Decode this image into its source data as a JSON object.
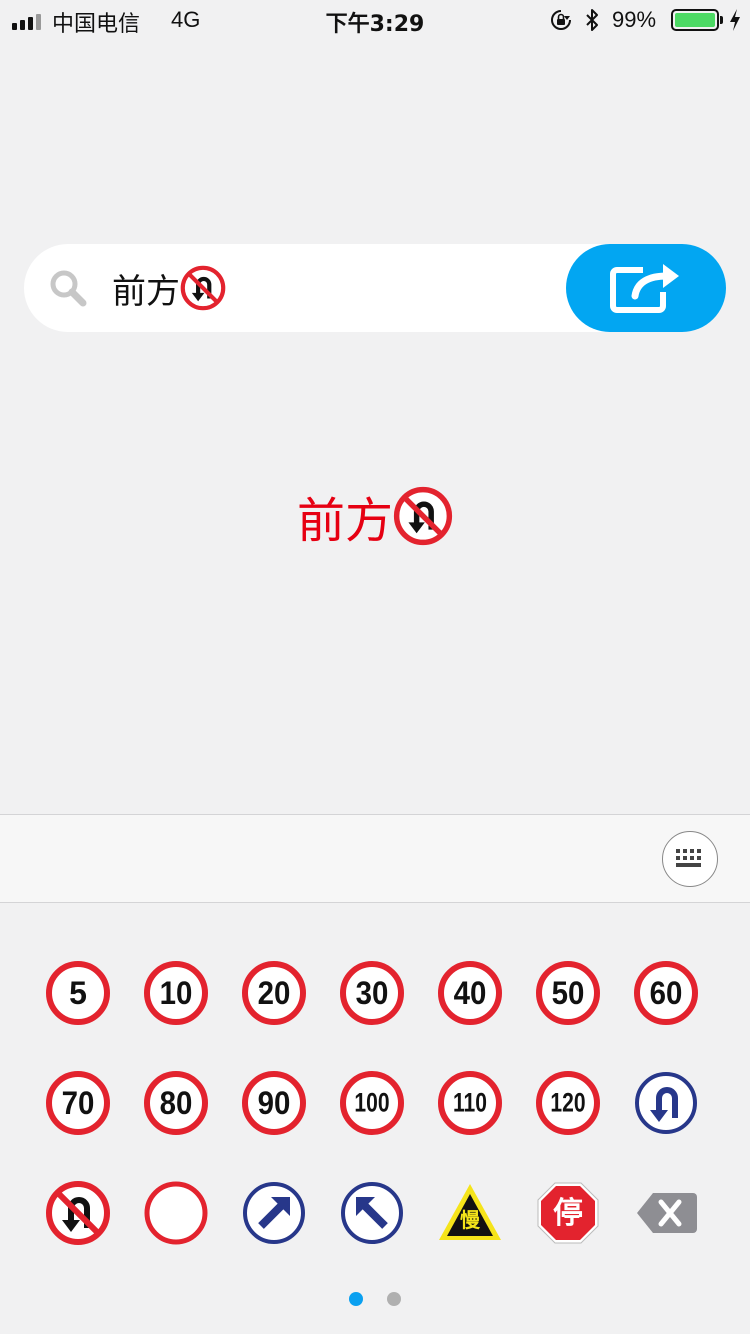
{
  "status_bar": {
    "carrier": "中国电信",
    "network": "4G",
    "time": "下午3:29",
    "battery_percent": "99%",
    "battery_level": 0.99,
    "icons": [
      "signal-icon",
      "orientation-lock-icon",
      "bluetooth-icon",
      "battery-icon",
      "charging-icon"
    ]
  },
  "search": {
    "text": "前方",
    "inline_sign": "no-u-turn",
    "share_icon": "share-icon"
  },
  "preview": {
    "text": "前方",
    "inline_sign": "no-u-turn",
    "color": "#e60012"
  },
  "toolbar": {
    "keyboard_icon": "keyboard-icon"
  },
  "signs": [
    {
      "type": "speed-limit",
      "label": "5"
    },
    {
      "type": "speed-limit",
      "label": "10"
    },
    {
      "type": "speed-limit",
      "label": "20"
    },
    {
      "type": "speed-limit",
      "label": "30"
    },
    {
      "type": "speed-limit",
      "label": "40"
    },
    {
      "type": "speed-limit",
      "label": "50"
    },
    {
      "type": "speed-limit",
      "label": "60"
    },
    {
      "type": "speed-limit",
      "label": "70"
    },
    {
      "type": "speed-limit",
      "label": "80"
    },
    {
      "type": "speed-limit",
      "label": "90"
    },
    {
      "type": "speed-limit",
      "label": "100"
    },
    {
      "type": "speed-limit",
      "label": "110"
    },
    {
      "type": "speed-limit",
      "label": "120"
    },
    {
      "type": "u-turn",
      "label": ""
    },
    {
      "type": "no-u-turn",
      "label": ""
    },
    {
      "type": "no-entry-blank",
      "label": ""
    },
    {
      "type": "arrow-up-right",
      "label": ""
    },
    {
      "type": "arrow-up-left",
      "label": ""
    },
    {
      "type": "slow",
      "label": "慢"
    },
    {
      "type": "stop",
      "label": "停"
    },
    {
      "type": "delete",
      "label": ""
    }
  ],
  "pager": {
    "pages": 2,
    "current": 1
  },
  "colors": {
    "accent": "#02a6f2",
    "sign_red": "#e3232e",
    "sign_blue": "#27378a",
    "slow_yellow": "#f5e41a",
    "background": "#f1f1f2"
  }
}
